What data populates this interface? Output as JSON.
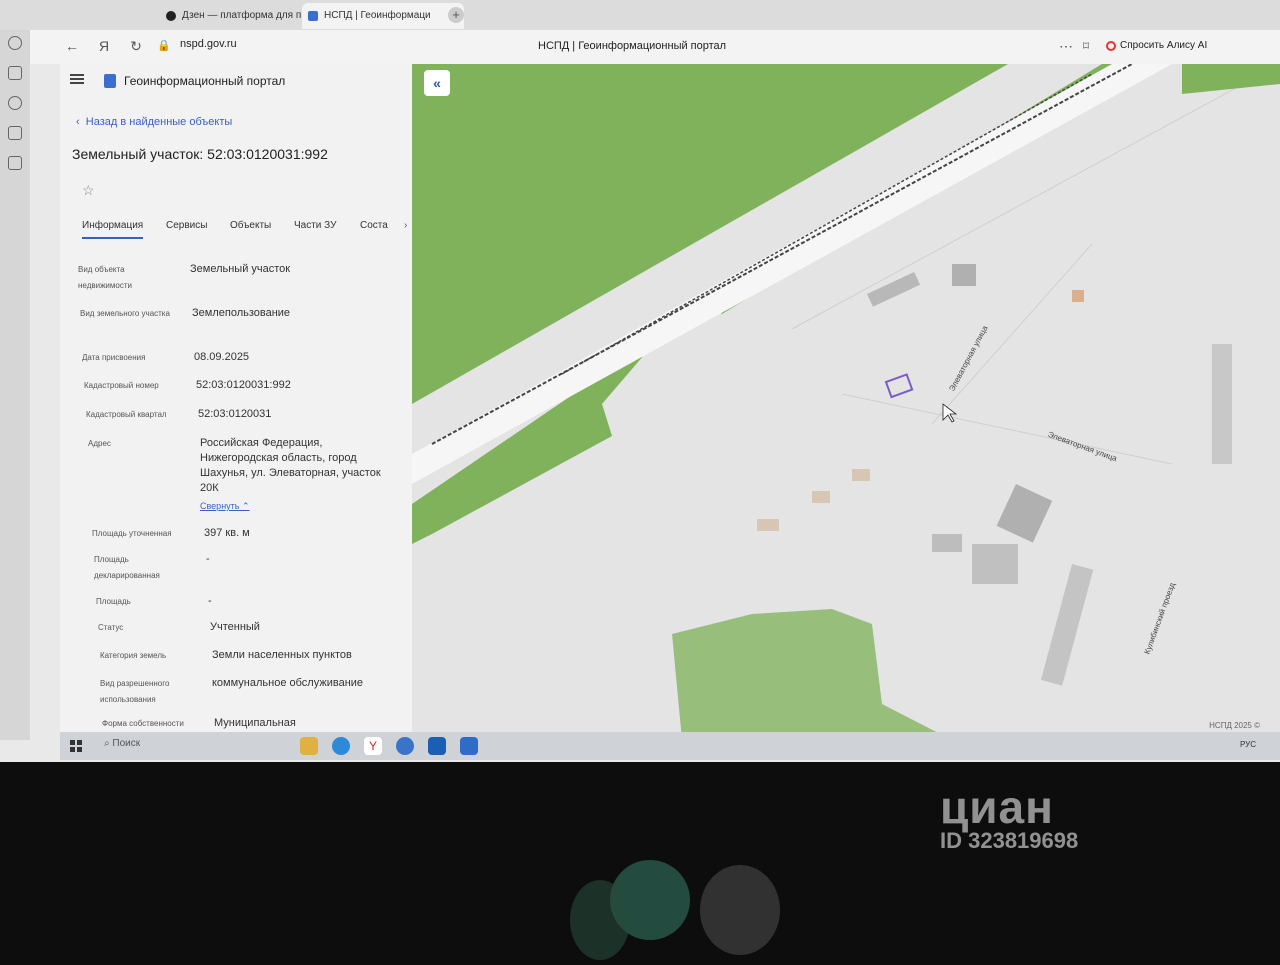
{
  "browser": {
    "tabs": [
      {
        "label": "Дзен — платформа для п"
      },
      {
        "label": "НСПД | Геоинформаци"
      }
    ],
    "url": "nspd.gov.ru",
    "page_title": "НСПД | Геоинформационный портал",
    "alice_label": "Спросить Алису AI"
  },
  "panel": {
    "portal_name": "Геоинформационный портал",
    "back_link": "Назад в найденные объекты",
    "title": "Земельный участок: 52:03:0120031:992",
    "tabs": [
      "Информация",
      "Сервисы",
      "Объекты",
      "Части ЗУ",
      "Соста"
    ],
    "properties": [
      {
        "label": "Вид объекта недвижимости",
        "value": "Земельный участок"
      },
      {
        "label": "Вид земельного участка",
        "value": "Землепользование"
      },
      {
        "label": "Дата присвоения",
        "value": "08.09.2025"
      },
      {
        "label": "Кадастровый номер",
        "value": "52:03:0120031:992"
      },
      {
        "label": "Кадастровый квартал",
        "value": "52:03:0120031"
      },
      {
        "label": "Адрес",
        "value": "Российская Федерация, Нижегородская область, город Шахунья, ул. Элеваторная, участок 20К"
      },
      {
        "label": "Площадь уточненная",
        "value": "397 кв. м"
      },
      {
        "label": "Площадь декларированная",
        "value": "-"
      },
      {
        "label": "Площадь",
        "value": "-"
      },
      {
        "label": "Статус",
        "value": "Учтенный"
      },
      {
        "label": "Категория земель",
        "value": "Земли населенных пунктов"
      },
      {
        "label": "Вид разрешенного использования",
        "value": "коммунальное обслуживание"
      },
      {
        "label": "Форма собственности",
        "value": "Муниципальная"
      }
    ],
    "collapse_link": "Свернуть"
  },
  "map": {
    "streets": [
      "Элеваторная улица",
      "Элеваторная улица",
      "Кулибинский проезд"
    ],
    "copyright": "НСПД 2025 ©",
    "colors": {
      "green": "#7fb25a",
      "road": "#f4f4f4",
      "building": "#b8b8b8",
      "parcel": "#7b5cc9"
    }
  },
  "taskbar": {
    "search_placeholder": "Поиск",
    "language": "РУС"
  },
  "watermark": {
    "brand": "циан",
    "id": "ID 323819698"
  }
}
